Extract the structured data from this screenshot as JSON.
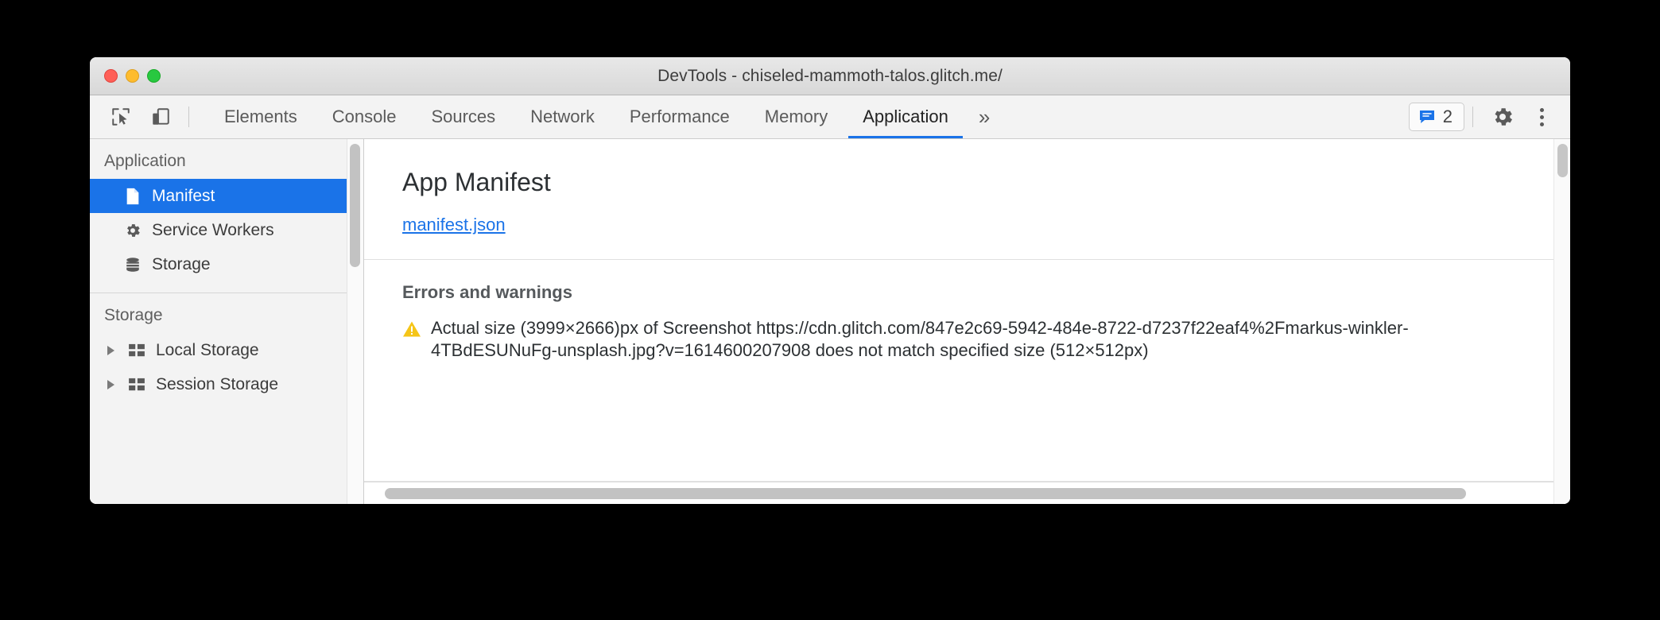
{
  "window": {
    "title": "DevTools - chiseled-mammoth-talos.glitch.me/",
    "traffic_lights": [
      "close",
      "minimize",
      "maximize"
    ],
    "accent_color": "#1a73e8",
    "warning_color": "#f5c518"
  },
  "toolbar": {
    "inspect_icon": "inspect-element-icon",
    "device_icon": "device-toolbar-icon",
    "tabs": [
      {
        "label": "Elements",
        "active": false
      },
      {
        "label": "Console",
        "active": false
      },
      {
        "label": "Sources",
        "active": false
      },
      {
        "label": "Network",
        "active": false
      },
      {
        "label": "Performance",
        "active": false
      },
      {
        "label": "Memory",
        "active": false
      },
      {
        "label": "Application",
        "active": true
      }
    ],
    "more_tabs_label": "»",
    "message_badge": {
      "icon": "message-bubble-icon",
      "count": "2"
    },
    "settings_icon": "gear-icon",
    "menu_icon": "kebab-menu-icon"
  },
  "sidebar": {
    "groups": [
      {
        "title": "Application",
        "items": [
          {
            "label": "Manifest",
            "icon": "document-icon",
            "selected": true,
            "tree": false
          },
          {
            "label": "Service Workers",
            "icon": "gear-icon",
            "selected": false,
            "tree": false
          },
          {
            "label": "Storage",
            "icon": "database-icon",
            "selected": false,
            "tree": false
          }
        ]
      },
      {
        "title": "Storage",
        "items": [
          {
            "label": "Local Storage",
            "icon": "table-icon",
            "selected": false,
            "tree": true
          },
          {
            "label": "Session Storage",
            "icon": "table-icon",
            "selected": false,
            "tree": true
          }
        ]
      }
    ]
  },
  "main": {
    "title": "App Manifest",
    "manifest_link": "manifest.json",
    "errors_section_title": "Errors and warnings",
    "warning": {
      "icon": "warning-triangle-icon",
      "text": "Actual size (3999×2666)px of Screenshot https://cdn.glitch.com/847e2c69-5942-484e-8722-d7237f22eaf4%2Fmarkus-winkler-4TBdESUNuFg-unsplash.jpg?v=1614600207908 does not match specified size (512×512px)"
    }
  }
}
